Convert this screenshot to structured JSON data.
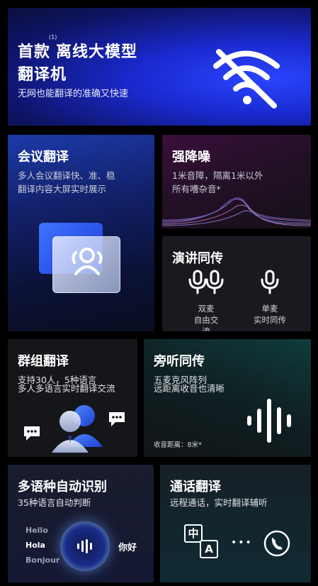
{
  "hero": {
    "title_prefix": "首款",
    "footnote": "(1)",
    "title_rest": "离线大模型",
    "title_line2": "翻译机",
    "description": "无网也能翻译的准确又快速"
  },
  "meeting": {
    "title": "会议翻译",
    "line1": "多人会议翻译快、准、稳",
    "line2": "翻译内容大屏实时展示"
  },
  "noise": {
    "title": "强降噪",
    "line1": "1米音障，隔离1米以外",
    "line2": "所有嘈杂音*"
  },
  "speech": {
    "title": "演讲同传",
    "dual_line1": "双麦",
    "dual_line2": "自由交流",
    "single_line1": "单麦",
    "single_line2": "实时同传"
  },
  "group": {
    "title": "群组翻译",
    "line1": "支持30人，5种语言",
    "line2": "多人多语言实时翻译交流"
  },
  "listen": {
    "title": "旁听同传",
    "line1": "五麦克风阵列",
    "line2": "远距离收音也清晰",
    "distance": "收音距离：8米*"
  },
  "auto": {
    "title": "多语种自动识别",
    "subtitle": "35种语言自动判断",
    "words": [
      "Hello",
      "Hola",
      "Bonjour"
    ],
    "result": "你好"
  },
  "call": {
    "title": "通话翻译",
    "subtitle": "远程通话，实时翻译辅听",
    "glyph_zh": "中",
    "glyph_a": "A",
    "dots": "•••"
  },
  "colors": {
    "hero_blue": "#1a2ad0",
    "accent_blue": "#2f6bff"
  }
}
